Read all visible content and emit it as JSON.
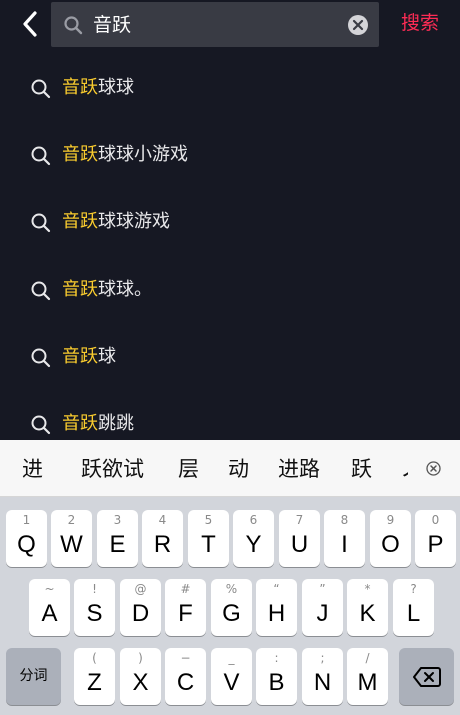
{
  "header": {
    "back_icon": "chevron-left-icon",
    "search_icon": "magnifier-icon",
    "query": "音跃",
    "clear_icon": "clear-circle-icon",
    "search_button": "搜索"
  },
  "colors": {
    "background": "#161823",
    "search_box": "#393b44",
    "highlight": "#facc2e",
    "search_button": "#fe2c55"
  },
  "suggestions": [
    {
      "highlight": "音跃",
      "rest": "球球"
    },
    {
      "highlight": "音跃",
      "rest": "球球小游戏"
    },
    {
      "highlight": "音跃",
      "rest": "球球游戏"
    },
    {
      "highlight": "音跃",
      "rest": "球球。"
    },
    {
      "highlight": "音跃",
      "rest": "球"
    },
    {
      "highlight": "音跃",
      "rest": "跳跳"
    }
  ],
  "candidates": {
    "words": [
      "进",
      "跃欲试",
      "层",
      "动",
      "进路",
      "跃",
      "ノ"
    ],
    "close_icon": "close-circle-icon"
  },
  "keyboard": {
    "row1": [
      {
        "sub": "1",
        "main": "Q"
      },
      {
        "sub": "2",
        "main": "W"
      },
      {
        "sub": "3",
        "main": "E"
      },
      {
        "sub": "4",
        "main": "R"
      },
      {
        "sub": "5",
        "main": "T"
      },
      {
        "sub": "6",
        "main": "Y"
      },
      {
        "sub": "7",
        "main": "U"
      },
      {
        "sub": "8",
        "main": "I"
      },
      {
        "sub": "9",
        "main": "O"
      },
      {
        "sub": "0",
        "main": "P"
      }
    ],
    "row2": [
      {
        "sub": "~",
        "main": "A"
      },
      {
        "sub": "!",
        "main": "S"
      },
      {
        "sub": "@",
        "main": "D"
      },
      {
        "sub": "#",
        "main": "F"
      },
      {
        "sub": "%",
        "main": "G"
      },
      {
        "sub": "“",
        "main": "H"
      },
      {
        "sub": "”",
        "main": "J"
      },
      {
        "sub": "*",
        "main": "K"
      },
      {
        "sub": "?",
        "main": "L"
      }
    ],
    "row3": [
      {
        "sub": "(",
        "main": "Z"
      },
      {
        "sub": ")",
        "main": "X"
      },
      {
        "sub": "−",
        "main": "C"
      },
      {
        "sub": "_",
        "main": "V"
      },
      {
        "sub": ":",
        "main": "B"
      },
      {
        "sub": ";",
        "main": "N"
      },
      {
        "sub": "/",
        "main": "M"
      }
    ],
    "split_key": "分词",
    "backspace_icon": "backspace-icon"
  }
}
